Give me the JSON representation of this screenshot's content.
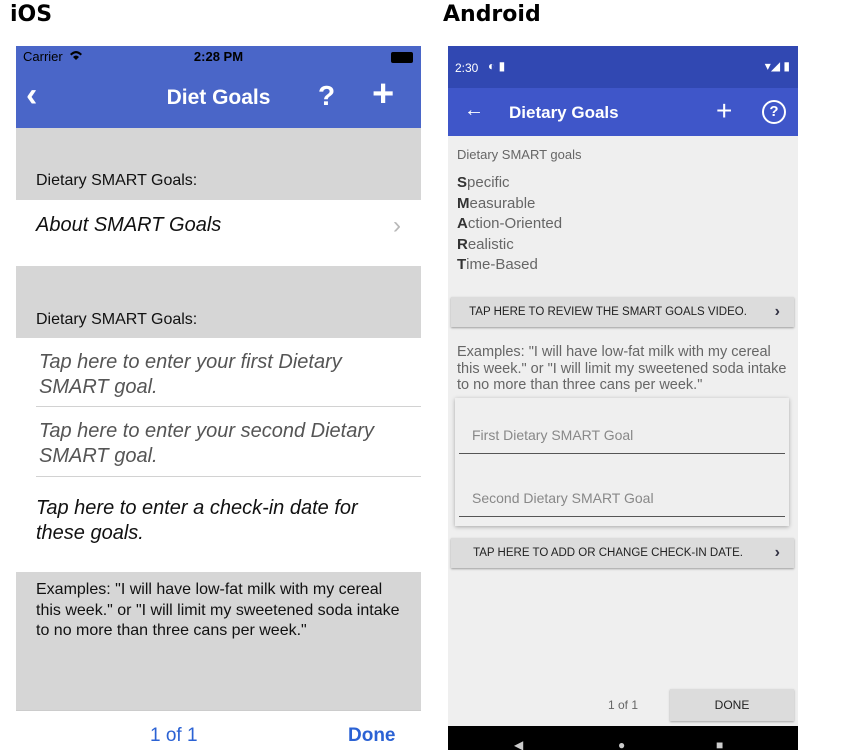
{
  "labels": {
    "ios": "iOS",
    "android": "Android"
  },
  "ios": {
    "status": {
      "carrier": "Carrier",
      "time": "2:28 PM"
    },
    "nav": {
      "back": "‹",
      "title": "Diet Goals",
      "help": "?",
      "add": "+"
    },
    "section1_header": "Dietary SMART Goals:",
    "about_label": "About SMART Goals",
    "chevron": "›",
    "section2_header": "Dietary SMART Goals:",
    "first_goal_placeholder": "Tap here to enter your first Dietary SMART goal.",
    "second_goal_placeholder": "Tap here to enter your second Dietary SMART goal.",
    "checkin_label": "Tap here to enter a check-in date for these goals.",
    "examples": "Examples: \"I will have low-fat milk with my cereal this week.\" or \"I will limit my sweetened soda intake to no more than three cans per week.\"",
    "toolbar": {
      "pages": "1 of 1",
      "done": "Done"
    }
  },
  "android": {
    "status": {
      "time": "2:30",
      "icons": "◐ ▮",
      "sys": "▾◢ ▮"
    },
    "appbar": {
      "back": "←",
      "title": "Dietary Goals",
      "add": "+",
      "help": "?"
    },
    "heading": "Dietary SMART goals",
    "smart": [
      {
        "letter": "S",
        "rest": "pecific"
      },
      {
        "letter": "M",
        "rest": "easurable"
      },
      {
        "letter": "A",
        "rest": "ction-Oriented"
      },
      {
        "letter": "R",
        "rest": "ealistic"
      },
      {
        "letter": "T",
        "rest": "ime-Based"
      }
    ],
    "video_button": "TAP HERE TO REVIEW THE SMART GOALS VIDEO.",
    "examples": "Examples: \"I will have low-fat milk with my cereal this week.\" or \"I will limit my sweetened soda intake to no more than three cans per week.\"",
    "first_goal_hint": "First Dietary SMART Goal",
    "second_goal_hint": "Second Dietary SMART Goal",
    "checkin_button": "TAP HERE TO ADD OR CHANGE CHECK-IN DATE.",
    "chevron": "›",
    "pages": "1 of 1",
    "done": "DONE"
  },
  "colors": {
    "ios_bar": "#4a66c8",
    "android_status": "#3148b2",
    "android_appbar": "#3f56c9",
    "ios_link": "#2b62d4"
  }
}
